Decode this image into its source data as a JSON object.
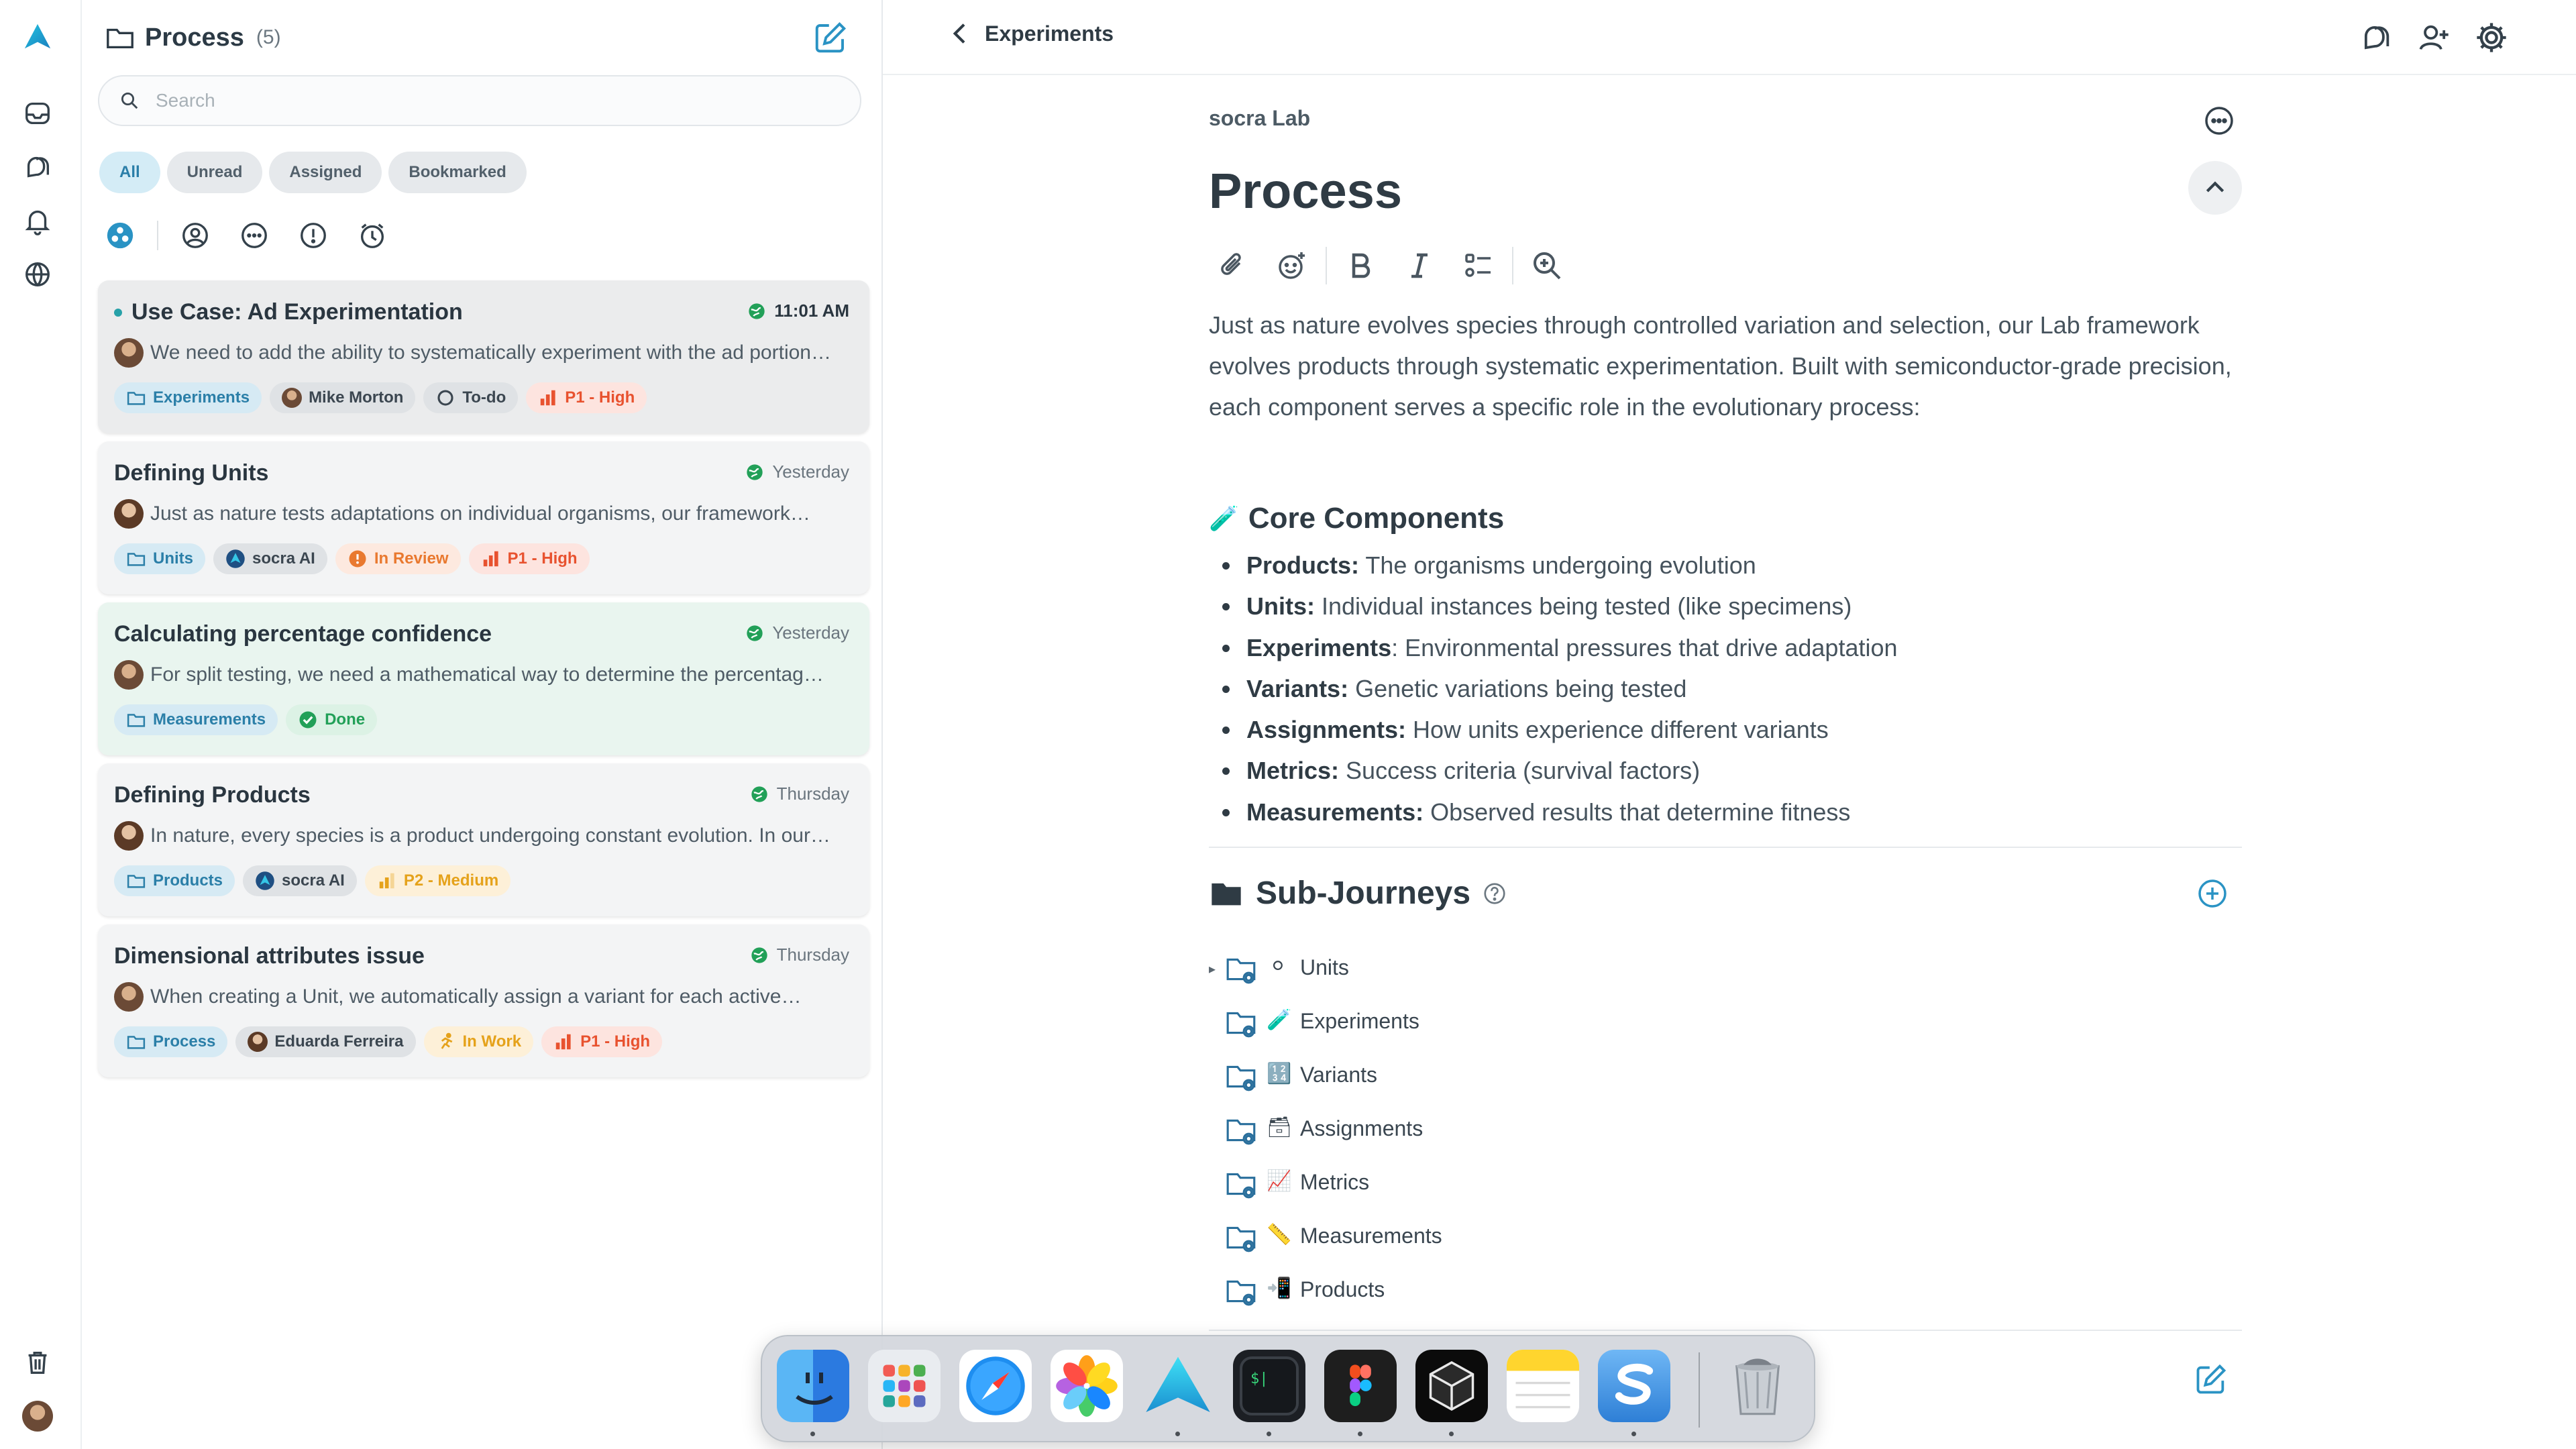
{
  "rail": {
    "icons": [
      "logo-icon",
      "inbox-icon",
      "chat-icon",
      "bell-icon",
      "globe-icon",
      "trash-icon",
      "user-avatar"
    ]
  },
  "list": {
    "title": "Process",
    "count": "(5)",
    "search_placeholder": "Search",
    "filters": [
      "All",
      "Unread",
      "Assigned",
      "Bookmarked"
    ],
    "cards": [
      {
        "title": "Use Case: Ad Experimentation",
        "time": "11:01 AM",
        "snippet": "We need to add the ability to systematically experiment with the ad portion…",
        "tags": [
          "Experiments",
          "Mike Morton",
          "To-do",
          "P1 - High"
        ]
      },
      {
        "title": "Defining Units",
        "time": "Yesterday",
        "snippet": "Just as nature tests adaptations on individual organisms, our framework…",
        "tags": [
          "Units",
          "socra AI",
          "In Review",
          "P1 - High"
        ]
      },
      {
        "title": "Calculating percentage confidence",
        "time": "Yesterday",
        "snippet": "For split testing, we need a mathematical way to determine the percentag…",
        "tags": [
          "Measurements",
          "Done"
        ]
      },
      {
        "title": "Defining Products",
        "time": "Thursday",
        "snippet": "In nature, every species is a product undergoing constant evolution. In our…",
        "tags": [
          "Products",
          "socra AI",
          "P2 - Medium"
        ]
      },
      {
        "title": "Dimensional attributes issue",
        "time": "Thursday",
        "snippet": "When creating a Unit, we automatically assign a variant for each active…",
        "tags": [
          "Process",
          "Eduarda Ferreira",
          "In Work",
          "P1 - High"
        ]
      }
    ]
  },
  "topbar": {
    "back_label": "Experiments"
  },
  "detail": {
    "org": "socra Lab",
    "title": "Process",
    "intro": "Just as nature evolves species through controlled variation and selection, our Lab framework evolves products through systematic experimentation. Built with semiconductor-grade precision, each component serves a specific role in the evolutionary process:",
    "core_heading": "Core Components",
    "core_emoji": "🧪",
    "bullets": [
      {
        "term": "Products:",
        "desc": " The organisms undergoing evolution"
      },
      {
        "term": "Units:",
        "desc": " Individual instances being tested (like specimens)"
      },
      {
        "term": "Experiments",
        "desc": ": Environmental pressures that drive adaptation"
      },
      {
        "term": "Variants:",
        "desc": " Genetic variations being tested"
      },
      {
        "term": "Assignments:",
        "desc": " How units experience different variants"
      },
      {
        "term": "Metrics:",
        "desc": " Success criteria (survival factors)"
      },
      {
        "term": "Measurements:",
        "desc": " Observed results that determine fitness"
      }
    ],
    "subjourneys_heading": "Sub-Journeys",
    "subjourneys": [
      {
        "emoji": "⚪",
        "label": "Units"
      },
      {
        "emoji": "🧪",
        "label": "Experiments"
      },
      {
        "emoji": "🔢",
        "label": "Variants"
      },
      {
        "emoji": "🗃",
        "label": "Assignments"
      },
      {
        "emoji": "📈",
        "label": "Metrics"
      },
      {
        "emoji": "📏",
        "label": "Measurements"
      },
      {
        "emoji": "📲",
        "label": "Products"
      }
    ]
  },
  "dock": {
    "apps": [
      "Finder",
      "Launchpad",
      "Safari",
      "Photos",
      "socra",
      "Terminal",
      "Figma",
      "Cursor",
      "Notes",
      "Scrivener",
      "Trash"
    ]
  },
  "colors": {
    "accent": "#2a93c4",
    "folder_tag_bg": "#d6eaf4",
    "high_priority": "#e8522f",
    "medium_priority": "#e5a21b",
    "done": "#22a058"
  }
}
